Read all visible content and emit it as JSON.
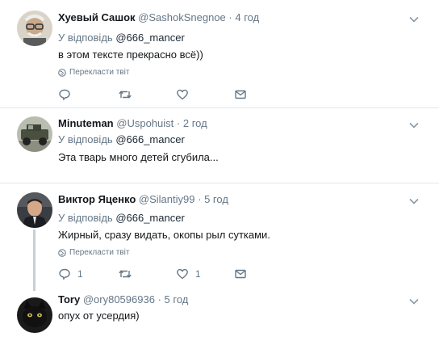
{
  "tweets": [
    {
      "name": "Хуевый Сашок",
      "handle": "@SashokSnegnoe",
      "dot": "·",
      "time": "4 год",
      "reply_prefix": "У відповідь",
      "reply_to": "@666_mancer",
      "text": "в этом тексте прекрасно всё))",
      "translate": "Перекласти твіт",
      "reply_count": "",
      "like_count": ""
    },
    {
      "name": "Minuteman",
      "handle": "@Uspohuist",
      "dot": "·",
      "time": "2 год",
      "reply_prefix": "У відповідь",
      "reply_to": "@666_mancer",
      "text": "Эта тварь много детей сгубила..."
    },
    {
      "name": "Виктор Яценко",
      "handle": "@Silantiy99",
      "dot": "·",
      "time": "5 год",
      "reply_prefix": "У відповідь",
      "reply_to": "@666_mancer",
      "text": "Жирный, сразу видать, окопы рыл сутками.",
      "translate": "Перекласти твіт",
      "reply_count": "1",
      "like_count": "1"
    },
    {
      "name": "Tory",
      "handle": "@ory80596936",
      "dot": "·",
      "time": "5 год",
      "text": "опух от усердия)"
    }
  ],
  "icons": {
    "reply": "reply-icon",
    "retweet": "retweet-icon",
    "like": "heart-icon",
    "dm": "envelope-icon",
    "globe": "globe-icon",
    "menu": "chevron-down-icon"
  },
  "colors": {
    "secondary_text": "#657786",
    "divider": "#e1e8ed",
    "thread_line": "#c7d0d6"
  }
}
